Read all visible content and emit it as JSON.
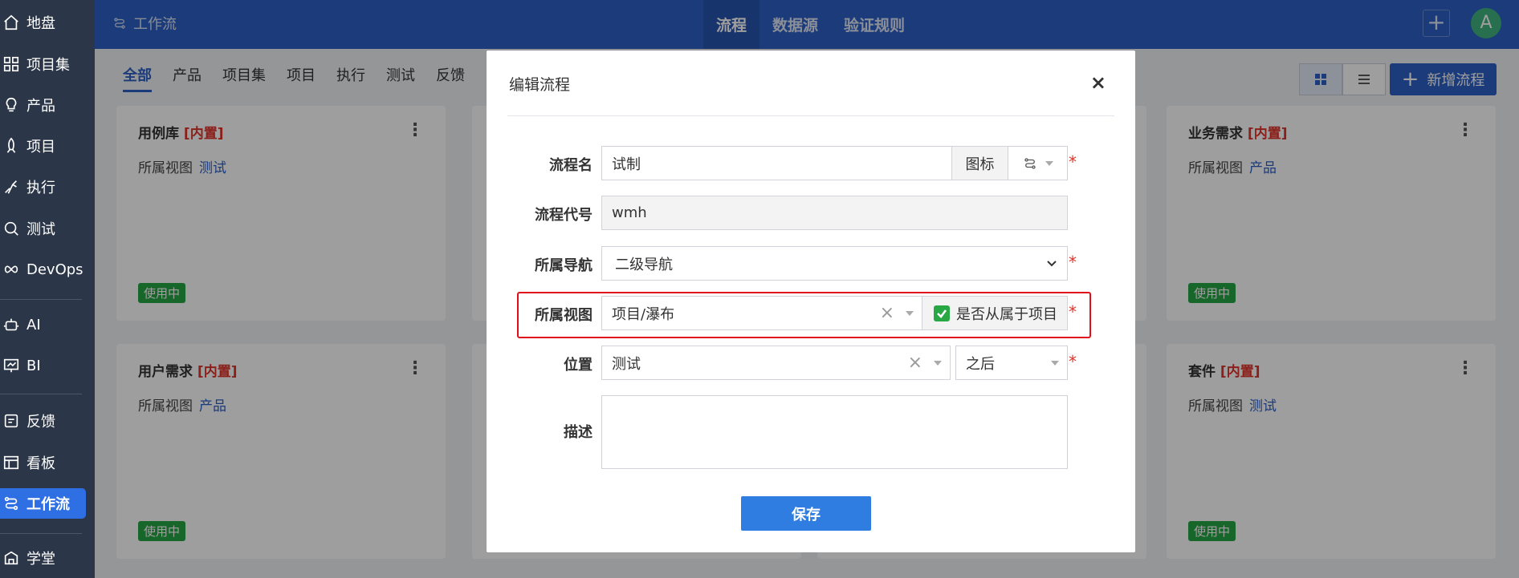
{
  "sidebar": {
    "items": [
      {
        "label": "地盘",
        "icon": "home-icon"
      },
      {
        "label": "项目集",
        "icon": "grid-icon"
      },
      {
        "label": "产品",
        "icon": "bulb-icon"
      },
      {
        "label": "项目",
        "icon": "rocket-icon"
      },
      {
        "label": "执行",
        "icon": "run-icon"
      },
      {
        "label": "测试",
        "icon": "search-bug-icon"
      },
      {
        "label": "DevOps",
        "icon": "infinity-icon"
      },
      {
        "label": "AI",
        "icon": "robot-icon"
      },
      {
        "label": "BI",
        "icon": "chart-board-icon"
      },
      {
        "label": "反馈",
        "icon": "feedback-icon"
      },
      {
        "label": "看板",
        "icon": "kanban-icon"
      },
      {
        "label": "工作流",
        "icon": "workflow-icon"
      },
      {
        "label": "学堂",
        "icon": "school-icon"
      }
    ],
    "active": "工作流"
  },
  "header": {
    "breadcrumb": "工作流",
    "nav": [
      "流程",
      "数据源",
      "验证规则"
    ],
    "nav_active": "流程",
    "plus": "+",
    "avatar": "A"
  },
  "tabs": [
    "全部",
    "产品",
    "项目集",
    "项目",
    "执行",
    "测试",
    "反馈"
  ],
  "tabs_active": "全部",
  "toolbar": {
    "new_label": "新增流程"
  },
  "cards": [
    {
      "name": "用例库",
      "tag": "[内置]",
      "view_label": "所属视图",
      "view": "测试",
      "status": "使用中"
    },
    {
      "name": "业务需求",
      "tag": "[内置]",
      "view_label": "所属视图",
      "view": "产品",
      "status": "使用中"
    },
    {
      "name": "用户需求",
      "tag": "[内置]",
      "view_label": "所属视图",
      "view": "产品",
      "status": "使用中"
    },
    {
      "name": "套件",
      "tag": "[内置]",
      "view_label": "所属视图",
      "view": "测试",
      "status": "使用中"
    }
  ],
  "modal": {
    "title": "编辑流程",
    "close": "×",
    "fields": {
      "name_label": "流程名",
      "name_value": "试制",
      "icon_label": "图标",
      "code_label": "流程代号",
      "code_value": "wmh",
      "nav_label": "所属导航",
      "nav_value": "二级导航",
      "view_label": "所属视图",
      "view_value": "项目/瀑布",
      "belongs_label": "是否从属于项目",
      "position_label": "位置",
      "position_value": "测试",
      "position_order": "之后",
      "desc_label": "描述",
      "desc_value": ""
    },
    "required_mark": "*",
    "save_label": "保存"
  }
}
